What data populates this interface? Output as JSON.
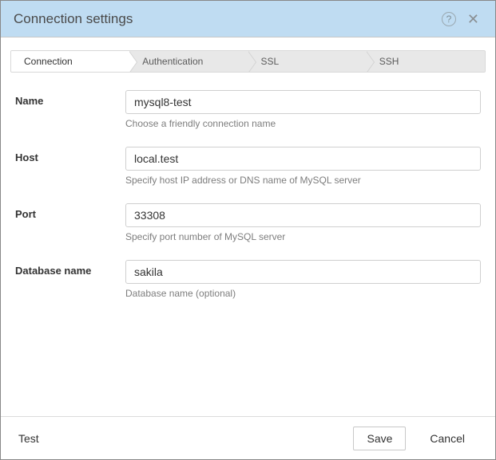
{
  "title": "Connection settings",
  "tabs": [
    {
      "label": "Connection",
      "active": true
    },
    {
      "label": "Authentication",
      "active": false
    },
    {
      "label": "SSL",
      "active": false
    },
    {
      "label": "SSH",
      "active": false
    }
  ],
  "fields": {
    "name": {
      "label": "Name",
      "value": "mysql8-test",
      "hint": "Choose a friendly connection name"
    },
    "host": {
      "label": "Host",
      "value": "local.test",
      "hint": "Specify host IP address or DNS name of MySQL server"
    },
    "port": {
      "label": "Port",
      "value": "33308",
      "hint": "Specify port number of MySQL server"
    },
    "database": {
      "label": "Database name",
      "value": "sakila",
      "hint": "Database name (optional)"
    }
  },
  "footer": {
    "test": "Test",
    "save": "Save",
    "cancel": "Cancel"
  }
}
